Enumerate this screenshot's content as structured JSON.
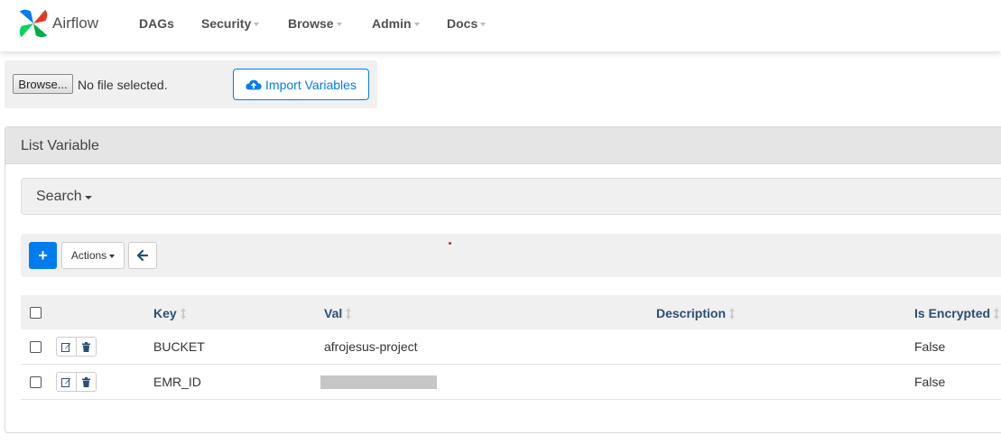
{
  "nav": {
    "brand": "Airflow",
    "items": [
      {
        "label": "DAGs",
        "has_caret": false
      },
      {
        "label": "Security",
        "has_caret": true
      },
      {
        "label": "Browse",
        "has_caret": true
      },
      {
        "label": "Admin",
        "has_caret": true
      },
      {
        "label": "Docs",
        "has_caret": true
      }
    ]
  },
  "import": {
    "browse_label": "Browse...",
    "file_status": "No file selected.",
    "import_label": "Import Variables"
  },
  "panel": {
    "title": "List Variable",
    "search_label": "Search",
    "actions_label": "Actions",
    "add_label": "+"
  },
  "table": {
    "columns": [
      "Key",
      "Val",
      "Description",
      "Is Encrypted"
    ],
    "rows": [
      {
        "key": "BUCKET",
        "val": "afrojesus-project",
        "description": "",
        "is_encrypted": "False",
        "val_masked": false
      },
      {
        "key": "EMR_ID",
        "val": "",
        "description": "",
        "is_encrypted": "False",
        "val_masked": true
      }
    ]
  },
  "colors": {
    "accent": "#017cee",
    "header_text": "#2b4f73",
    "nav_text": "#51504f"
  },
  "icons": [
    "airflow-logo-icon",
    "cloud-upload-icon",
    "plus-icon",
    "arrow-left-icon",
    "sort-icon",
    "edit-icon",
    "trash-icon",
    "caret-down-icon"
  ]
}
